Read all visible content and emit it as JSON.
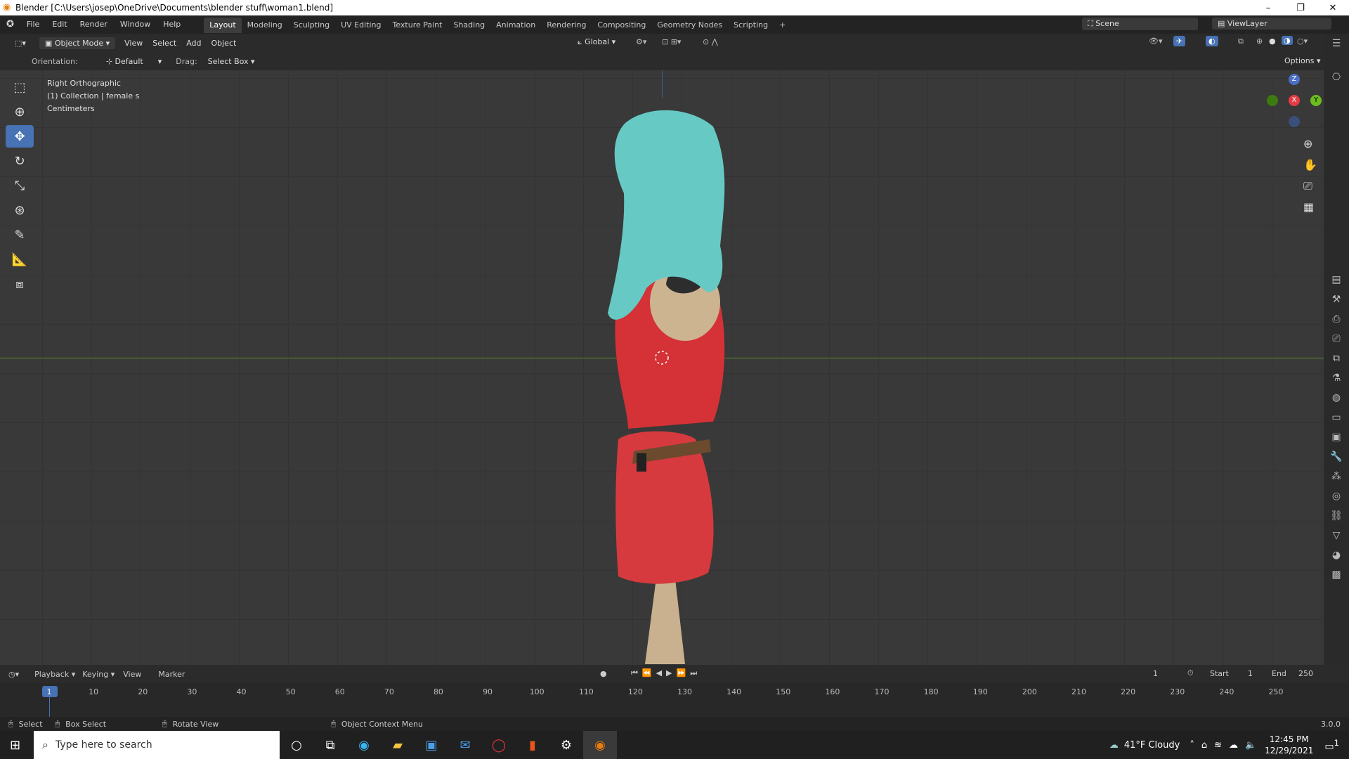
{
  "window": {
    "title": "Blender [C:\\Users\\josep\\OneDrive\\Documents\\blender stuff\\woman1.blend]",
    "minimize": "–",
    "maximize": "❐",
    "close": "✕"
  },
  "menu": [
    "File",
    "Edit",
    "Render",
    "Window",
    "Help"
  ],
  "workspaces": [
    "Layout",
    "Modeling",
    "Sculpting",
    "UV Editing",
    "Texture Paint",
    "Shading",
    "Animation",
    "Rendering",
    "Compositing",
    "Geometry Nodes",
    "Scripting",
    "+"
  ],
  "scene": "Scene",
  "view_layer": "ViewLayer",
  "header": {
    "mode": "Object Mode",
    "view": "View",
    "select": "Select",
    "add": "Add",
    "object": "Object",
    "transform": "Global"
  },
  "tool_settings": {
    "orientation_label": "Orientation:",
    "orientation": "Default",
    "drag_label": "Drag:",
    "drag": "Select Box",
    "options": "Options"
  },
  "viewport_info": {
    "view": "Right Orthographic",
    "collection": "(1) Collection | female s",
    "units": "Centimeters"
  },
  "gizmo": {
    "z": "Z",
    "y": "Y",
    "x": "X"
  },
  "timeline": {
    "playback": "Playback",
    "keying": "Keying",
    "view": "View",
    "marker": "Marker",
    "current_frame": "1",
    "start_label": "Start",
    "start": "1",
    "end_label": "End",
    "end": "250",
    "ticks": [
      "1",
      "10",
      "20",
      "30",
      "40",
      "50",
      "60",
      "70",
      "80",
      "90",
      "100",
      "110",
      "120",
      "130",
      "140",
      "150",
      "160",
      "170",
      "180",
      "190",
      "200",
      "210",
      "220",
      "230",
      "240",
      "250"
    ]
  },
  "status": {
    "select": "Select",
    "box_select": "Box Select",
    "rotate_view": "Rotate View",
    "context_menu": "Object Context Menu",
    "version": "3.0.0"
  },
  "taskbar": {
    "search_placeholder": "Type here to search",
    "weather": "41°F  Cloudy",
    "time": "12:45 PM",
    "date": "12/29/2021",
    "notif": "1"
  }
}
